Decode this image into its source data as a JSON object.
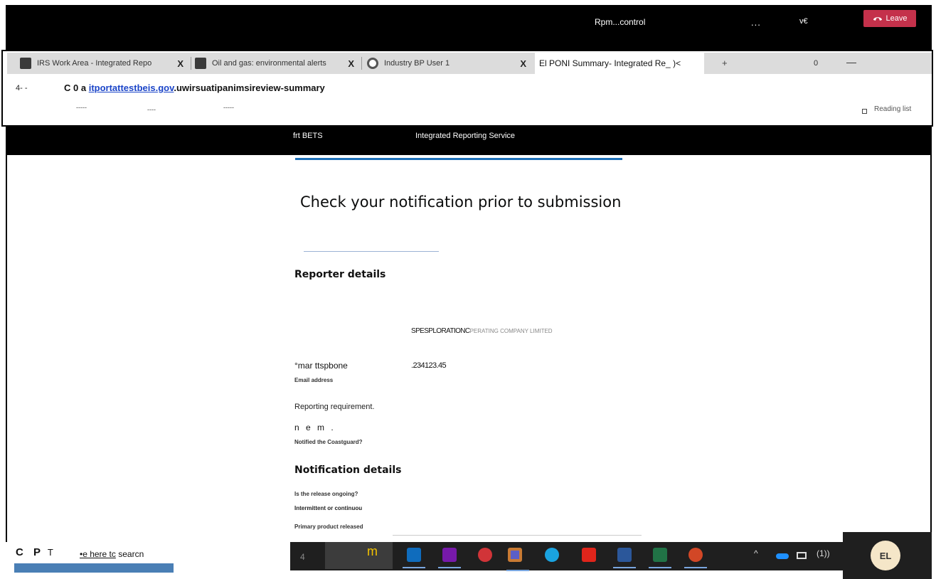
{
  "meeting": {
    "title": "Rpm...control",
    "more_label": "...",
    "control_label": "v€",
    "leave_label": "Leave",
    "leave_color": "#c4314b"
  },
  "browser": {
    "tabs": [
      {
        "title": "IRS Work Area - Integrated Repo",
        "icon": "site-favicon"
      },
      {
        "title": "Oil and gas: environmental alerts",
        "icon": "site-favicon"
      },
      {
        "title": "Industry BP User 1",
        "icon": "globe-icon"
      }
    ],
    "tab_close": "X",
    "active_tab_title": "El PONI Summary- Integrated Re_ )<",
    "new_tab_label": "+",
    "restore_count": "0",
    "minimize_label": "—",
    "back_label": "4- -",
    "address_prefix": "C 0 a",
    "address_domain": "itportattestbeis.gov",
    "address_path": ".uwirsuatipanimsireview-summary",
    "bookmark_dashes": [
      "-----",
      "----",
      "-----"
    ],
    "reading_list_label": "Reading list"
  },
  "site": {
    "logo_text": "frt BETS",
    "service_name": "Integrated Reporting Service",
    "accent_color": "#1d70b8"
  },
  "page": {
    "title": "Check your notification prior to submission",
    "reporter_heading": "Reporter details",
    "operator_name": "SPESPLORATIONC",
    "operator_name_faint": "PERATING COMPANY LIMITED",
    "phone_label": "°mar ttspbone",
    "phone_value": ".234123.45",
    "email_label": "Email address",
    "reporting_label": "Reporting requirement.",
    "reporting_value": "n e m .",
    "coastguard_label": "Notified the Coastguard?",
    "notification_heading": "Notification details",
    "ongoing_label": "Is the release ongoing?",
    "intermittent_label": "Intermittent or continuou",
    "primary_product_label": "Primary product released"
  },
  "taskbar": {
    "start_c": "C",
    "start_p": "P",
    "start_t": "T",
    "search_text_1": "•e here tc",
    "search_text_2": "searcn",
    "task_view_label": "4",
    "active_glyph": "m",
    "apps": [
      {
        "name": "outlook-icon",
        "color": "#0f6cbd"
      },
      {
        "name": "onenote-icon",
        "color": "#7719aa"
      },
      {
        "name": "paint-icon",
        "color": "#d13438"
      },
      {
        "name": "teams-icon",
        "color": "#5b5fc7"
      },
      {
        "name": "edge-icon",
        "color": "#1aa3e0"
      },
      {
        "name": "acrobat-icon",
        "color": "#e0251b"
      },
      {
        "name": "word-icon",
        "color": "#2b579a"
      },
      {
        "name": "excel-icon",
        "color": "#217346"
      },
      {
        "name": "powerpoint-icon",
        "color": "#d24726"
      }
    ],
    "tray_chevron": "^",
    "tray_volume": "(1))",
    "avatar_initials": "EL"
  }
}
